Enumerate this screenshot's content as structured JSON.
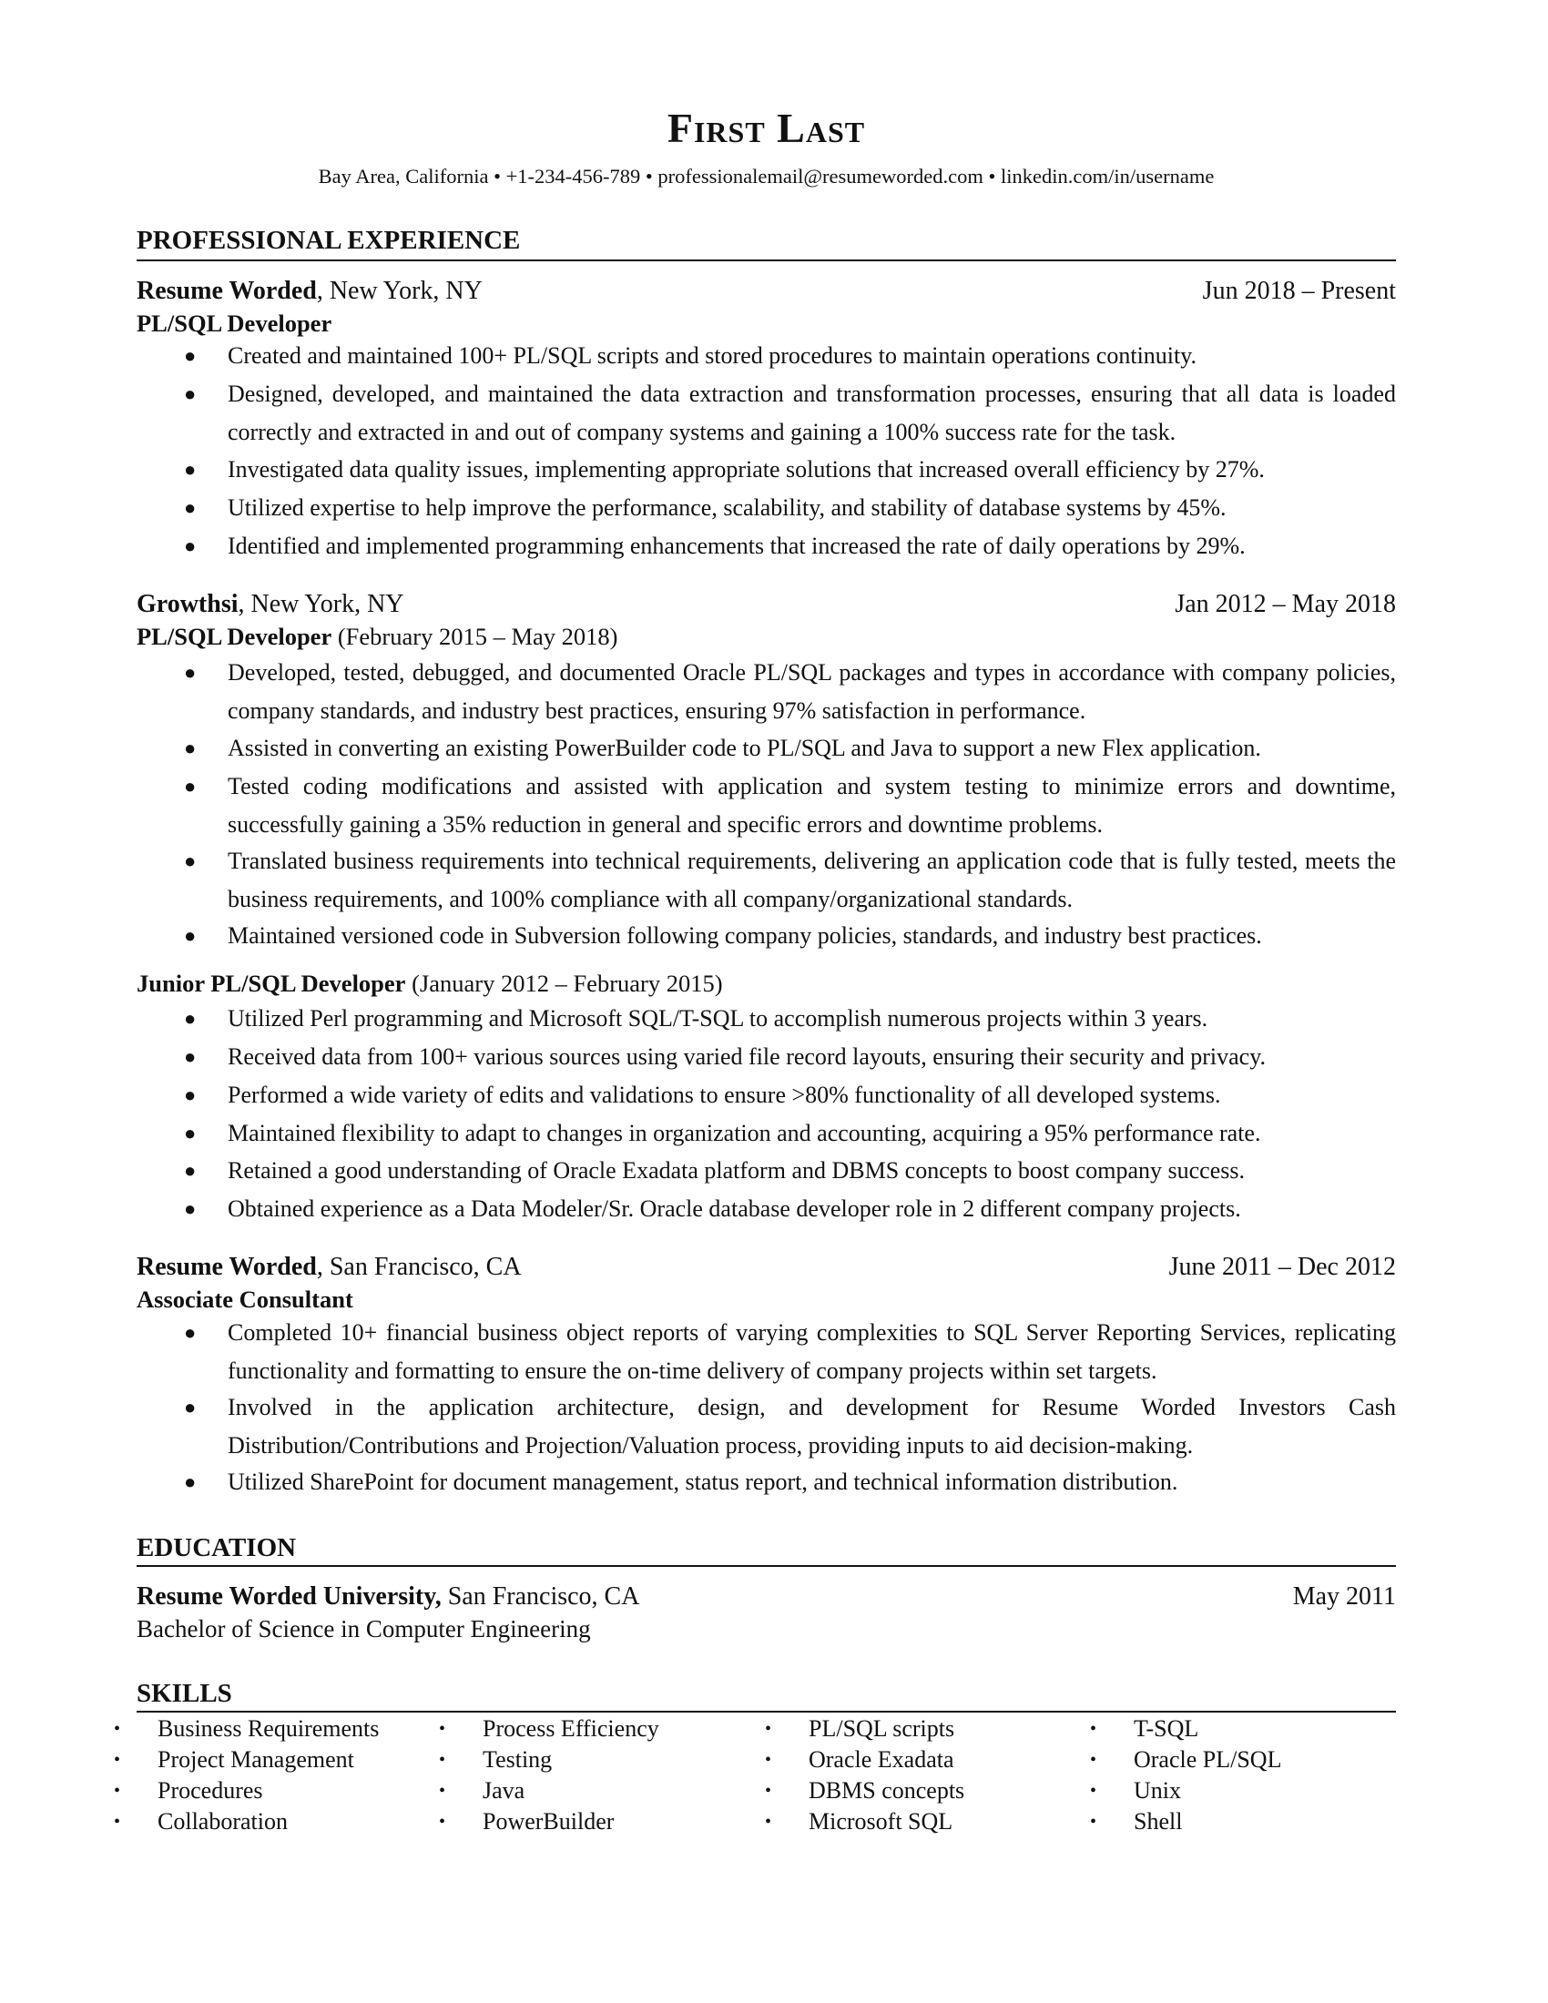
{
  "header": {
    "name": "First Last",
    "contact": "Bay Area, California • +1-234-456-789 • professionalemail@resumeworded.com • linkedin.com/in/username"
  },
  "sections": {
    "experience_title": "PROFESSIONAL EXPERIENCE",
    "education_title": "EDUCATION",
    "skills_title": "SKILLS"
  },
  "experience": [
    {
      "company": "Resume Worded",
      "location": ", New York, NY",
      "dates": "Jun 2018 – Present",
      "roles": [
        {
          "title": "PL/SQL Developer",
          "period": "",
          "bullets": [
            "Created and maintained 100+ PL/SQL scripts and stored procedures to maintain operations continuity.",
            "Designed, developed, and maintained the data extraction and transformation processes, ensuring that all data is loaded correctly and extracted in and out of company systems and gaining a 100% success rate for the task.",
            "Investigated data quality issues, implementing appropriate solutions that increased overall efficiency by 27%.",
            "Utilized expertise to help improve the performance, scalability, and stability of database systems by 45%.",
            "Identified and implemented programming enhancements that increased the rate of daily operations by 29%."
          ]
        }
      ]
    },
    {
      "company": "Growthsi",
      "location": ", New York, NY",
      "dates": "Jan 2012 – May 2018",
      "roles": [
        {
          "title": "PL/SQL Developer",
          "period": " (February  2015 – May 2018)",
          "bullets": [
            "Developed, tested, debugged, and documented Oracle PL/SQL packages and types in accordance with company policies, company standards, and industry best practices, ensuring 97% satisfaction in performance.",
            "Assisted in converting an existing PowerBuilder code to PL/SQL and Java to support a new Flex application.",
            "Tested coding modifications and assisted with application and system testing to minimize errors and downtime, successfully gaining a 35% reduction in general and specific errors and downtime problems.",
            "Translated business requirements into technical requirements, delivering an application code that is fully tested, meets the business requirements, and 100% compliance with all company/organizational standards.",
            "Maintained versioned code in Subversion following company policies, standards, and industry best practices."
          ]
        },
        {
          "title": "Junior PL/SQL Developer",
          "period": " (January 2012 – February 2015)",
          "bullets": [
            "Utilized Perl programming and Microsoft SQL/T-SQL to accomplish numerous projects within 3 years.",
            "Received data from 100+ various sources using varied file record layouts, ensuring their security and privacy.",
            "Performed a wide variety of edits and validations to ensure >80% functionality of all developed systems.",
            "Maintained flexibility to adapt to changes in organization and accounting, acquiring a 95% performance rate.",
            "Retained a good understanding of Oracle Exadata platform and DBMS concepts to boost company success.",
            "Obtained experience as a Data Modeler/Sr. Oracle database developer role in 2 different company projects."
          ]
        }
      ]
    },
    {
      "company": "Resume Worded",
      "location": ", San Francisco, CA",
      "dates": "June 2011 – Dec 2012",
      "roles": [
        {
          "title": "Associate Consultant",
          "period": "",
          "bullets": [
            "Completed 10+ financial business object reports of varying complexities to SQL Server Reporting Services, replicating functionality and formatting to ensure the on-time delivery of company projects within set targets.",
            "Involved in the application architecture, design, and development for Resume Worded Investors Cash Distribution/Contributions and Projection/Valuation process, providing inputs to aid decision-making.",
            "Utilized SharePoint for document management, status report, and technical information distribution."
          ]
        }
      ]
    }
  ],
  "education": {
    "school": "Resume Worded University,",
    "location": " San Francisco, CA",
    "date": "May 2011",
    "degree": "Bachelor of Science in Computer Engineering"
  },
  "skills": {
    "bullet_glyph": "•",
    "columns": [
      [
        "Business Requirements",
        "Project Management",
        "Procedures",
        "Collaboration"
      ],
      [
        "Process Efficiency",
        "Testing",
        "Java",
        "PowerBuilder"
      ],
      [
        "PL/SQL scripts",
        "Oracle Exadata",
        "DBMS concepts",
        "Microsoft SQL"
      ],
      [
        "T-SQL",
        "Oracle PL/SQL",
        "Unix",
        "Shell"
      ]
    ]
  },
  "bullet_glyph": "●"
}
